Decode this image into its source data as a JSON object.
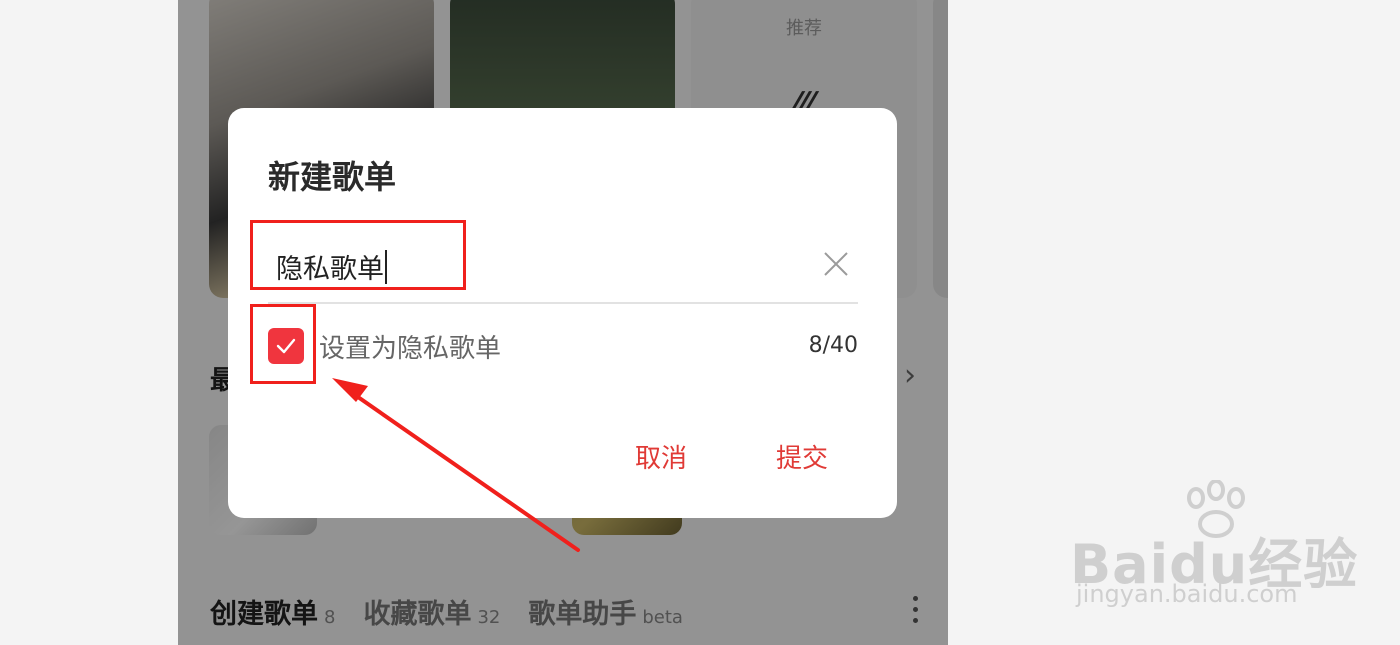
{
  "background": {
    "recommend_card_label": "推荐",
    "section_heading": "最",
    "tabs": [
      {
        "label": "创建歌单",
        "count": "8"
      },
      {
        "label": "收藏歌单",
        "count": "32"
      },
      {
        "label": "歌单助手",
        "count": "beta"
      }
    ]
  },
  "dialog": {
    "title": "新建歌单",
    "name_value": "隐私歌单",
    "private_checkbox_checked": true,
    "private_label": "设置为隐私歌单",
    "char_count": "8/40",
    "cancel_label": "取消",
    "submit_label": "提交"
  },
  "icons": [
    "close-icon",
    "checkmark-icon",
    "chevron-right-icon",
    "more-vertical-icon"
  ],
  "colors": {
    "accent": "#f0353e",
    "button_text": "#e03a36",
    "annotation": "#f0201c",
    "dim_overlay": "rgba(0,0,0,0.40)"
  },
  "watermark": {
    "logo_text": "Baidu经验",
    "url": "jingyan.baidu.com"
  }
}
